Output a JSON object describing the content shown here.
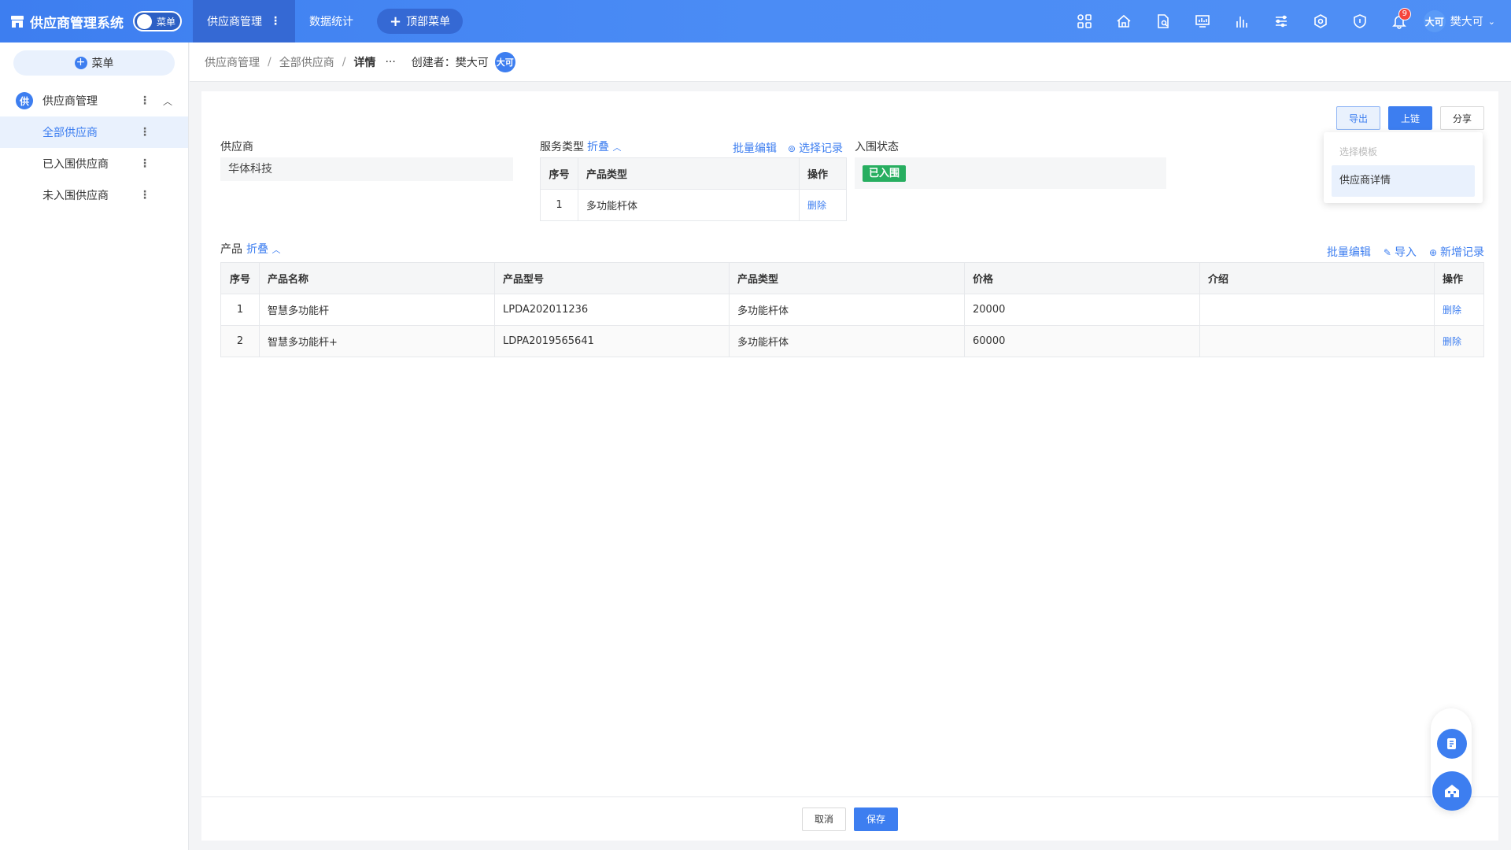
{
  "app": {
    "title": "供应商管理系统",
    "toggle_label": "菜单"
  },
  "topnav": {
    "tabs": [
      {
        "label": "供应商管理",
        "active": true
      },
      {
        "label": "数据统计",
        "active": false
      }
    ],
    "top_menu_button": "顶部菜单",
    "icons": [
      "apps-icon",
      "home-icon",
      "document-search-icon",
      "monitor-chart-icon",
      "bar-chart-icon",
      "list-icon",
      "network-icon",
      "shield-icon"
    ],
    "notification_count": "9",
    "user": {
      "avatar_text": "大可",
      "name": "樊大可"
    }
  },
  "sidebar": {
    "menu_button": "菜单",
    "group": {
      "icon_text": "供",
      "label": "供应商管理"
    },
    "items": [
      {
        "label": "全部供应商",
        "active": true
      },
      {
        "label": "已入围供应商",
        "active": false
      },
      {
        "label": "未入围供应商",
        "active": false
      }
    ]
  },
  "breadcrumb": {
    "items": [
      "供应商管理",
      "全部供应商",
      "详情"
    ],
    "creator_label": "创建者：",
    "creator_name": "樊大可",
    "creator_avatar": "大可"
  },
  "actions": {
    "export": "导出",
    "chain": "上链",
    "share": "分享"
  },
  "export_dropdown": {
    "header": "选择模板",
    "items": [
      "供应商详情"
    ]
  },
  "form": {
    "supplier_label": "供应商",
    "supplier_value": "华体科技",
    "service_type_label": "服务类型",
    "fold": "折叠",
    "batch_edit": "批量编辑",
    "select_record": "选择记录",
    "status_label": "入围状态",
    "status_value": "已入围",
    "service_table": {
      "headers": [
        "序号",
        "产品类型",
        "操作"
      ],
      "rows": [
        {
          "no": "1",
          "type": "多功能杆体",
          "op": "删除"
        }
      ]
    }
  },
  "products": {
    "label": "产品",
    "fold": "折叠",
    "batch_edit": "批量编辑",
    "import": "导入",
    "add_record": "新增记录",
    "headers": [
      "序号",
      "产品名称",
      "产品型号",
      "产品类型",
      "价格",
      "介绍",
      "操作"
    ],
    "rows": [
      {
        "no": "1",
        "name": "智慧多功能杆",
        "model": "LPDA202011236",
        "type": "多功能杆体",
        "price": "20000",
        "intro": "",
        "op": "删除"
      },
      {
        "no": "2",
        "name": "智慧多功能杆+",
        "model": "LDPA2019565641",
        "type": "多功能杆体",
        "price": "60000",
        "intro": "",
        "op": "删除"
      }
    ]
  },
  "footer": {
    "cancel": "取消",
    "save": "保存"
  },
  "colors": {
    "primary": "#3d7ef0",
    "success": "#27ae60",
    "badge": "#f5443c"
  }
}
